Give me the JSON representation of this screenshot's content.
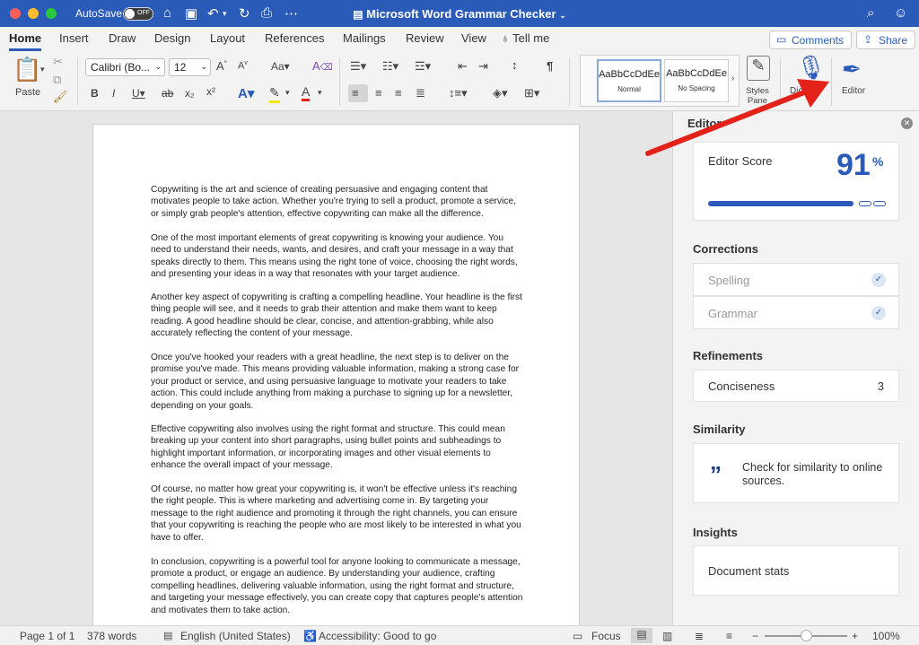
{
  "window": {
    "title": "Microsoft Word Grammar Checker",
    "autosave_label": "AutoSave",
    "autosave_state": "OFF"
  },
  "tabs": [
    "Home",
    "Insert",
    "Draw",
    "Design",
    "Layout",
    "References",
    "Mailings",
    "Review",
    "View"
  ],
  "tell_me": "Tell me",
  "top_buttons": {
    "comments": "Comments",
    "share": "Share"
  },
  "ribbon": {
    "paste": "Paste",
    "font_name": "Calibri (Bo...",
    "font_size": "12",
    "styles": [
      {
        "sample": "AaBbCcDdEe",
        "name": "Normal"
      },
      {
        "sample": "AaBbCcDdEe",
        "name": "No Spacing"
      }
    ],
    "styles_pane": "Styles Pane",
    "dictate": "Dictate",
    "editor": "Editor"
  },
  "document": {
    "paragraphs": [
      "Copywriting is the art and science of creating persuasive and engaging content that motivates people to take action. Whether you're trying to sell a product, promote a service, or simply grab people's attention, effective copywriting can make all the difference.",
      "One of the most important elements of great copywriting is knowing your audience. You need to understand their needs, wants, and desires, and craft your message in a way that speaks directly to them. This means using the right tone of voice, choosing the right words, and presenting your ideas in a way that resonates with your target audience.",
      "Another key aspect of copywriting is crafting a compelling headline. Your headline is the first thing people will see, and it needs to grab their attention and make them want to keep reading. A good headline should be clear, concise, and attention-grabbing, while also accurately reflecting the content of your message.",
      "Once you've hooked your readers with a great headline, the next step is to deliver on the promise you've made. This means providing valuable information, making a strong case for your product or service, and using persuasive language to motivate your readers to take action. This could include anything from making a purchase to signing up for a newsletter, depending on your goals.",
      "Effective copywriting also involves using the right format and structure. This could mean breaking up your content into short paragraphs, using bullet points and subheadings to highlight important information, or incorporating images and other visual elements to enhance the overall impact of your message.",
      "Of course, no matter how great your copywriting is, it won't be effective unless it's reaching the right people. This is where marketing and advertising come in. By targeting your message to the right audience and promoting it through the right channels, you can ensure that your copywriting is reaching the people who are most likely to be interested in what you have to offer.",
      "In conclusion, copywriting is a powerful tool for anyone looking to communicate a message, promote a product, or engage an audience. By understanding your audience, crafting compelling headlines, delivering valuable information, using the right format and structure, and targeting your message effectively, you can create copy that captures people's attention and motivates them to take action."
    ]
  },
  "editor_pane": {
    "title": "Editor",
    "score_label": "Editor Score",
    "score_value": "91",
    "score_unit": "%",
    "score_progress": 0.91,
    "corrections_heading": "Corrections",
    "corrections": [
      "Spelling",
      "Grammar"
    ],
    "refinements_heading": "Refinements",
    "refinement": {
      "label": "Conciseness",
      "count": "3"
    },
    "similarity_heading": "Similarity",
    "similarity_text": "Check for similarity to online sources.",
    "insights_heading": "Insights",
    "insights_item": "Document stats"
  },
  "status": {
    "page": "Page 1 of 1",
    "words": "378 words",
    "language": "English (United States)",
    "accessibility": "Accessibility: Good to go",
    "focus": "Focus",
    "zoom": "100%"
  },
  "colors": {
    "title_bar": "#2a5bb8",
    "accent": "#2a5bb8",
    "arrow": "#e32219"
  }
}
